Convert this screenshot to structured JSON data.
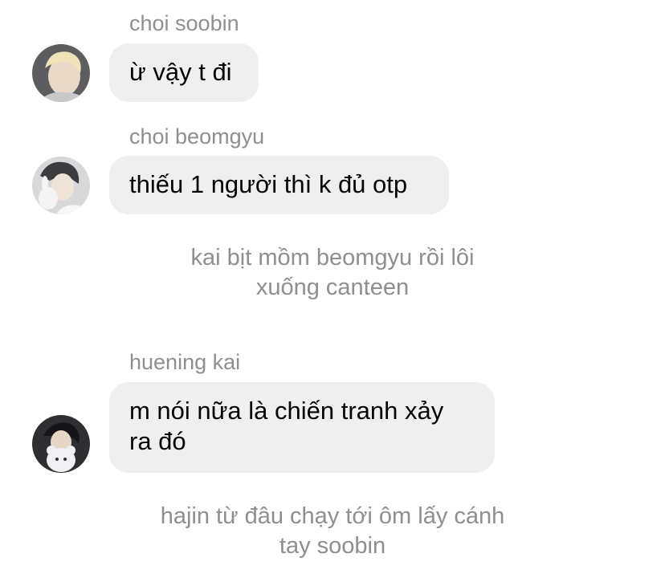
{
  "messages": [
    {
      "sender": "choi soobin",
      "text": "ừ vậy t đi",
      "avatar": "avatar-blonde-boy"
    },
    {
      "sender": "choi beomgyu",
      "text": "thiếu 1 người thì k đủ otp",
      "avatar": "avatar-boy-with-plush"
    },
    {
      "sender": "huening kai",
      "text_lines": [
        "m nói nữa là chiến tranh xảy",
        "ra đó"
      ],
      "avatar": "avatar-boy-with-bear"
    }
  ],
  "narrations": [
    {
      "lines": [
        "kai bịt mồm beomgyu rồi lôi",
        "xuống canteen"
      ]
    },
    {
      "lines": [
        "hajin từ đâu chạy tới ôm lấy cánh",
        "tay soobin"
      ]
    }
  ],
  "colors": {
    "bubble": "#efefef",
    "sender": "#8e8e93",
    "narration": "#8e8e93",
    "text": "#050505"
  }
}
